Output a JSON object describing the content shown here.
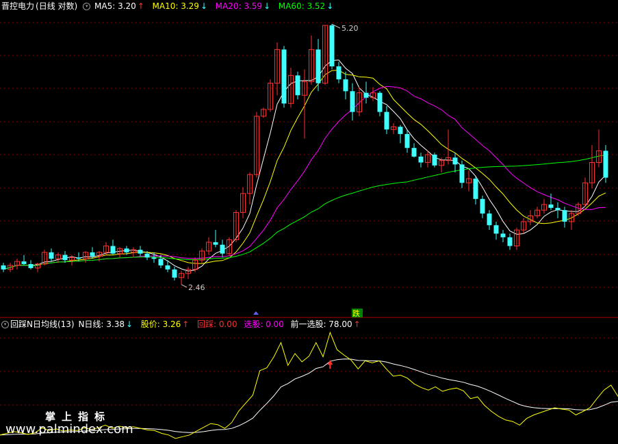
{
  "main_header": {
    "title": "晋控电力",
    "period": "(日线 对数)",
    "ma5": {
      "label": "MA5: 3.20",
      "arrow": "↑",
      "color": "#ffffff"
    },
    "ma10": {
      "label": "MA10: 3.29",
      "arrow": "↓",
      "color": "#ffff00"
    },
    "ma20": {
      "label": "MA20: 3.59",
      "arrow": "↓",
      "color": "#ff00ff"
    },
    "ma60": {
      "label": "MA60: 3.52",
      "arrow": "↓",
      "color": "#00ff00"
    }
  },
  "sub_header": {
    "title": "回踩N日均线(13)",
    "n_line": {
      "label": "N日线: 3.38",
      "arrow": "↓",
      "color": "#ffffff"
    },
    "price": {
      "label": "股价: 3.26",
      "arrow": "↑",
      "color": "#ffff00"
    },
    "pullback": {
      "label": "回踩: 0.00",
      "color": "#ff3030"
    },
    "select": {
      "label": "选股: 0.00",
      "color": "#ff00ff"
    },
    "prev_select": {
      "label": "前一选股: 78.00",
      "arrow": "↑",
      "color": "#ffffff"
    }
  },
  "annotations": {
    "high_label": "5.20",
    "low_label": "2.46",
    "fall_label": "跌"
  },
  "watermark": {
    "cn": "掌上指标",
    "url": "www.palmindex.com"
  },
  "colors": {
    "up": "#ff3030",
    "down": "#40ffff",
    "grid": "#8b0000",
    "ma5": "#ffffff",
    "ma10": "#ffff00",
    "ma20": "#ff00ff",
    "ma60": "#00ff00"
  },
  "chart_data": [
    {
      "type": "candlestick",
      "scale": "log",
      "ylim": [
        2.3,
        5.4
      ],
      "candles": [
        [
          2.6,
          2.62,
          2.55,
          2.57
        ],
        [
          2.57,
          2.62,
          2.55,
          2.6
        ],
        [
          2.6,
          2.65,
          2.57,
          2.63
        ],
        [
          2.63,
          2.68,
          2.6,
          2.61
        ],
        [
          2.61,
          2.64,
          2.57,
          2.58
        ],
        [
          2.58,
          2.62,
          2.55,
          2.61
        ],
        [
          2.61,
          2.72,
          2.6,
          2.7
        ],
        [
          2.7,
          2.73,
          2.63,
          2.65
        ],
        [
          2.65,
          2.7,
          2.62,
          2.68
        ],
        [
          2.68,
          2.71,
          2.62,
          2.64
        ],
        [
          2.64,
          2.68,
          2.6,
          2.66
        ],
        [
          2.66,
          2.7,
          2.63,
          2.65
        ],
        [
          2.65,
          2.71,
          2.62,
          2.7
        ],
        [
          2.7,
          2.74,
          2.65,
          2.67
        ],
        [
          2.67,
          2.71,
          2.63,
          2.7
        ],
        [
          2.7,
          2.78,
          2.68,
          2.75
        ],
        [
          2.75,
          2.8,
          2.68,
          2.69
        ],
        [
          2.69,
          2.74,
          2.66,
          2.73
        ],
        [
          2.73,
          2.75,
          2.68,
          2.7
        ],
        [
          2.7,
          2.74,
          2.66,
          2.72
        ],
        [
          2.72,
          2.75,
          2.67,
          2.69
        ],
        [
          2.69,
          2.71,
          2.64,
          2.66
        ],
        [
          2.66,
          2.7,
          2.62,
          2.65
        ],
        [
          2.65,
          2.68,
          2.58,
          2.6
        ],
        [
          2.6,
          2.64,
          2.55,
          2.57
        ],
        [
          2.57,
          2.59,
          2.49,
          2.51
        ],
        [
          2.51,
          2.56,
          2.46,
          2.54
        ],
        [
          2.54,
          2.59,
          2.5,
          2.57
        ],
        [
          2.57,
          2.66,
          2.55,
          2.64
        ],
        [
          2.64,
          2.73,
          2.62,
          2.71
        ],
        [
          2.71,
          2.82,
          2.68,
          2.78
        ],
        [
          2.78,
          2.88,
          2.74,
          2.76
        ],
        [
          2.76,
          2.8,
          2.66,
          2.69
        ],
        [
          2.69,
          2.82,
          2.67,
          2.8
        ],
        [
          2.8,
          3.05,
          2.78,
          3.03
        ],
        [
          3.03,
          3.26,
          2.98,
          3.2
        ],
        [
          3.2,
          3.4,
          3.1,
          3.38
        ],
        [
          3.38,
          4.05,
          3.35,
          4.0
        ],
        [
          4.0,
          4.1,
          3.98,
          4.08
        ],
        [
          4.08,
          4.45,
          4.05,
          4.4
        ],
        [
          4.4,
          4.95,
          4.25,
          4.85
        ],
        [
          4.85,
          4.9,
          4.1,
          4.15
        ],
        [
          4.15,
          4.6,
          4.1,
          4.5
        ],
        [
          4.5,
          4.55,
          4.2,
          4.25
        ],
        [
          4.25,
          4.58,
          3.75,
          4.42
        ],
        [
          4.42,
          5.05,
          4.38,
          4.85
        ],
        [
          4.85,
          5.0,
          4.3,
          4.4
        ],
        [
          4.4,
          5.2,
          4.38,
          5.2
        ],
        [
          5.2,
          5.22,
          4.58,
          4.62
        ],
        [
          4.62,
          4.68,
          4.4,
          4.45
        ],
        [
          4.45,
          4.55,
          4.2,
          4.3
        ],
        [
          4.3,
          4.4,
          3.95,
          4.05
        ],
        [
          4.05,
          4.35,
          4.0,
          4.28
        ],
        [
          4.28,
          4.42,
          4.15,
          4.22
        ],
        [
          4.22,
          4.35,
          4.18,
          4.28
        ],
        [
          4.28,
          4.3,
          4.0,
          4.05
        ],
        [
          4.05,
          4.12,
          3.8,
          3.85
        ],
        [
          3.85,
          3.92,
          3.8,
          3.88
        ],
        [
          3.88,
          3.9,
          3.7,
          3.8
        ],
        [
          3.8,
          3.85,
          3.6,
          3.65
        ],
        [
          3.65,
          3.7,
          3.55,
          3.56
        ],
        [
          3.56,
          3.6,
          3.45,
          3.5
        ],
        [
          3.5,
          3.62,
          3.45,
          3.58
        ],
        [
          3.58,
          3.6,
          3.45,
          3.47
        ],
        [
          3.47,
          3.55,
          3.4,
          3.52
        ],
        [
          3.52,
          3.85,
          3.48,
          3.55
        ],
        [
          3.55,
          3.6,
          3.4,
          3.48
        ],
        [
          3.48,
          3.52,
          3.25,
          3.3
        ],
        [
          3.3,
          3.42,
          3.22,
          3.34
        ],
        [
          3.34,
          3.36,
          3.1,
          3.15
        ],
        [
          3.15,
          3.18,
          2.98,
          3.02
        ],
        [
          3.02,
          3.05,
          2.88,
          2.92
        ],
        [
          2.92,
          2.95,
          2.8,
          2.85
        ],
        [
          2.85,
          2.88,
          2.78,
          2.82
        ],
        [
          2.82,
          2.85,
          2.72,
          2.75
        ],
        [
          2.75,
          2.9,
          2.72,
          2.88
        ],
        [
          2.88,
          2.98,
          2.85,
          2.95
        ],
        [
          2.95,
          3.05,
          2.92,
          3.0
        ],
        [
          3.0,
          3.08,
          2.98,
          3.05
        ],
        [
          3.05,
          3.15,
          3.02,
          3.1
        ],
        [
          3.1,
          3.2,
          3.05,
          3.07
        ],
        [
          3.07,
          3.12,
          2.98,
          3.05
        ],
        [
          3.05,
          3.08,
          2.9,
          2.95
        ],
        [
          2.95,
          3.05,
          2.88,
          3.02
        ],
        [
          3.02,
          3.12,
          3.0,
          3.1
        ],
        [
          3.1,
          3.35,
          3.08,
          3.3
        ],
        [
          3.3,
          3.68,
          3.25,
          3.5
        ],
        [
          3.5,
          3.85,
          3.45,
          3.62
        ],
        [
          3.62,
          3.68,
          3.3,
          3.35
        ]
      ],
      "ma_periods": [
        5,
        10,
        20,
        60
      ],
      "high_point": 5.2,
      "low_point": 2.46
    },
    {
      "type": "line",
      "title": "回踩N日均线(13)",
      "series": [
        {
          "name": "N日线",
          "color": "#ffffff"
        },
        {
          "name": "股价",
          "color": "#ffff00"
        }
      ],
      "last_values": {
        "N日线": 3.38,
        "股价": 3.26,
        "回踩": 0.0,
        "选股": 0.0,
        "前一选股": 78.0
      }
    }
  ]
}
